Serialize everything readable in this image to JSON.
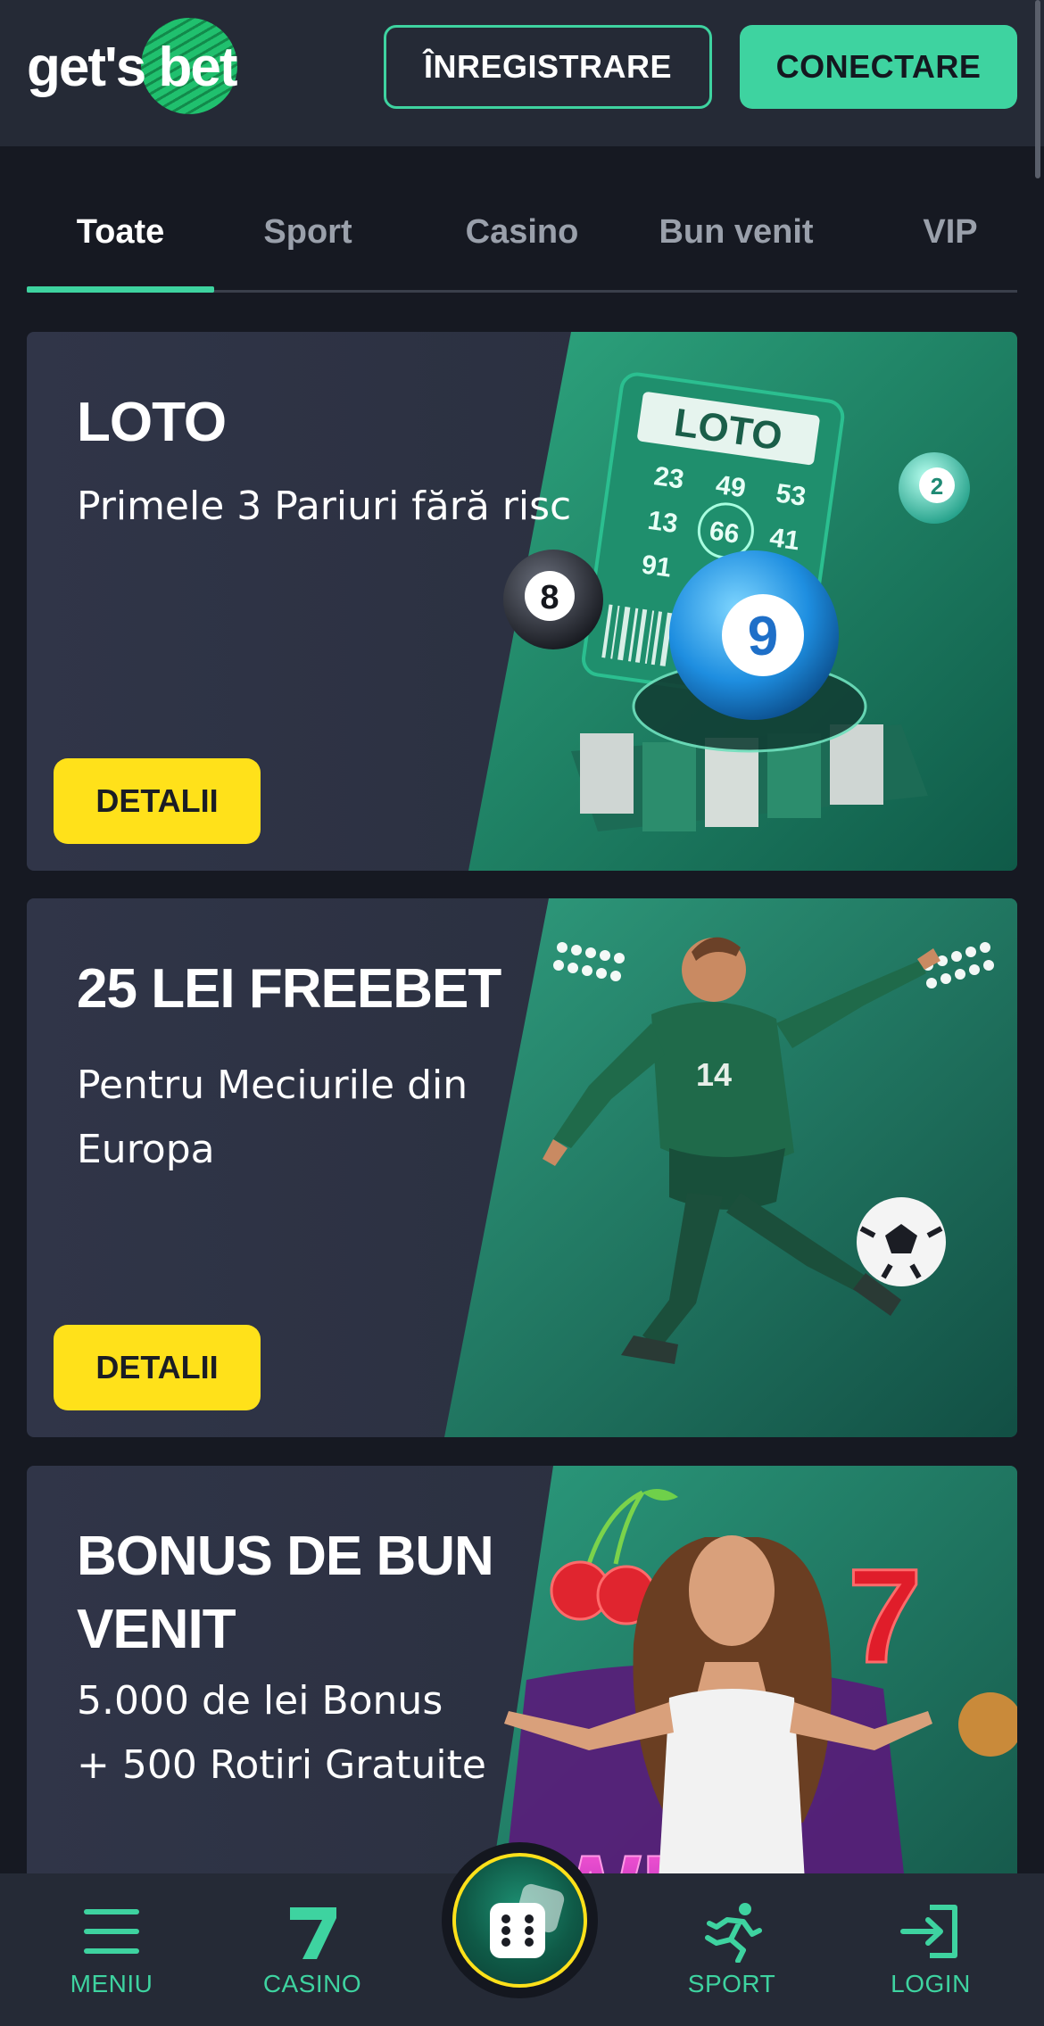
{
  "header": {
    "logo_text_left": "get's",
    "logo_text_right": "bet",
    "register_label": "ÎNREGISTRARE",
    "connect_label": "CONECTARE"
  },
  "tabs": [
    {
      "label": "Toate",
      "active": true
    },
    {
      "label": "Sport",
      "active": false
    },
    {
      "label": "Casino",
      "active": false
    },
    {
      "label": "Bun venit",
      "active": false
    },
    {
      "label": "VIP",
      "active": false
    }
  ],
  "promos": [
    {
      "title": "LOTO",
      "subtitle": "Primele 3 Pariuri fără risc",
      "button": "DETALII",
      "art": {
        "ticket_title": "LOTO",
        "ticket_numbers": [
          "23",
          "49",
          "53",
          "13",
          "66",
          "41",
          "91"
        ],
        "balls": [
          "8",
          "9",
          "2"
        ]
      }
    },
    {
      "title": "25 LEI FREEBET",
      "subtitle_line1": "Pentru Meciurile din",
      "subtitle_line2": "Europa",
      "button": "DETALII",
      "art": {
        "player_number": "14"
      }
    },
    {
      "title_line1": "BONUS DE BUN",
      "title_line2": "VENIT",
      "subtitle_line1": "5.000 de lei Bonus",
      "subtitle_line2": "+ 500 Rotiri Gratuite",
      "art": {
        "neon_symbol": "7",
        "neon_word": "WIN"
      }
    }
  ],
  "bottom_nav": [
    {
      "label": "MENIU",
      "icon": "menu-icon"
    },
    {
      "label": "CASINO",
      "icon": "seven-icon"
    },
    {
      "label": "",
      "icon": "dice-icon"
    },
    {
      "label": "SPORT",
      "icon": "runner-icon"
    },
    {
      "label": "LOGIN",
      "icon": "login-icon"
    }
  ],
  "colors": {
    "accent": "#3ed3a0",
    "cta_yellow": "#ffe11a",
    "background": "#161922",
    "bar": "#252a36"
  }
}
